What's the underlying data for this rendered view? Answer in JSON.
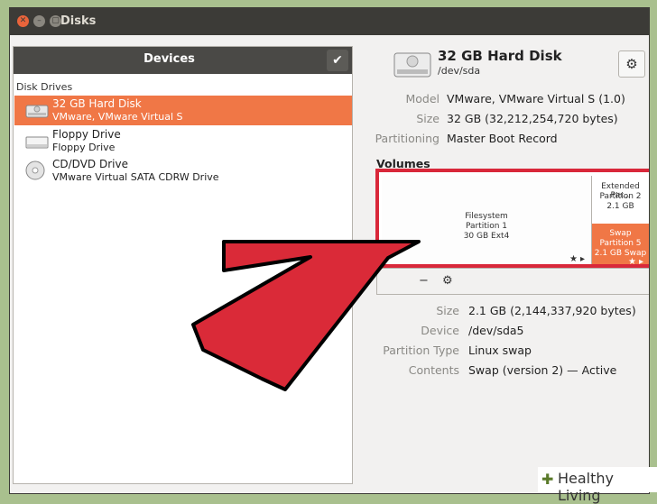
{
  "window": {
    "title": "Disks"
  },
  "devices": {
    "header": "Devices",
    "section_label": "Disk Drives",
    "drives": [
      {
        "name": "32 GB Hard Disk",
        "sub": "VMware, VMware Virtual S"
      },
      {
        "name": "Floppy Drive",
        "sub": "Floppy Drive"
      },
      {
        "name": "CD/DVD Drive",
        "sub": "VMware Virtual SATA CDRW Drive"
      }
    ]
  },
  "disk": {
    "title": "32 GB Hard Disk",
    "device": "/dev/sda",
    "fields": [
      {
        "key": "Model",
        "value": "VMware, VMware Virtual S (1.0)"
      },
      {
        "key": "Size",
        "value": "32 GB (32,212,254,720 bytes)"
      },
      {
        "key": "Partitioning",
        "value": "Master Boot Record"
      }
    ]
  },
  "volumes": {
    "label": "Volumes",
    "filesystem": {
      "line1": "Filesystem",
      "line2": "Partition 1",
      "line3": "30 GB Ext4"
    },
    "extended": {
      "line1": "Extended Par...",
      "line2": "Partition 2",
      "line3": "2.1 GB"
    },
    "swap": {
      "line1": "Swap",
      "line2": "Partition 5",
      "line3": "2.1 GB Swap"
    },
    "toolbar": {
      "minus": "−",
      "gear": "⚙"
    }
  },
  "partition": {
    "fields": [
      {
        "key": "Size",
        "value": "2.1 GB (2,144,337,920 bytes)"
      },
      {
        "key": "Device",
        "value": "/dev/sda5"
      },
      {
        "key": "Partition Type",
        "value": "Linux swap"
      },
      {
        "key": "Contents",
        "value": "Swap (version 2) — Active"
      }
    ]
  },
  "watermark": {
    "text": "Healthy Living"
  },
  "colors": {
    "accent": "#f07746",
    "highlight": "#d9283a",
    "titlebar": "#3c3b37"
  }
}
